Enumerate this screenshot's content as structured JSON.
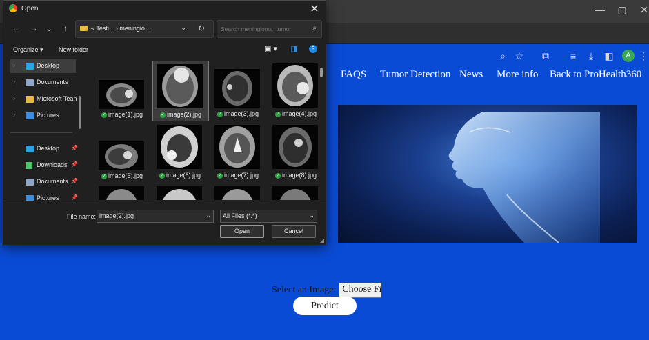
{
  "browser": {
    "window_controls": [
      "—",
      "▢",
      "✕"
    ],
    "avatar_initial": "A"
  },
  "site": {
    "nav": [
      "FAQS",
      "Tumor Detection",
      "News",
      "More info",
      "Back to ProHealth360"
    ],
    "upload_label": "Select an Image:",
    "choose_button": "Choose Fi",
    "predict_button": "Predict"
  },
  "dialog": {
    "title": "Open",
    "breadcrumb": "« Testi...  ›  meningio...",
    "search_placeholder": "Search meningioma_tumor",
    "organize": "Organize ▾",
    "new_folder": "New folder",
    "sidebar": [
      {
        "label": "Desktop",
        "icon": "desktop-icon",
        "color": "#2aa3e0",
        "selected": true,
        "chevron": true
      },
      {
        "label": "Documents",
        "icon": "documents-icon",
        "color": "#8fa6c8",
        "chevron": true
      },
      {
        "label": "Microsoft Tean",
        "icon": "folder-icon",
        "color": "#e8b949",
        "chevron": true
      },
      {
        "label": "Pictures",
        "icon": "pictures-icon",
        "color": "#3b8fe0",
        "chevron": true
      },
      {
        "label": "Desktop",
        "icon": "desktop-icon",
        "color": "#2aa3e0",
        "pinned": true
      },
      {
        "label": "Downloads",
        "icon": "downloads-icon",
        "color": "#4cc36b",
        "pinned": true
      },
      {
        "label": "Documents",
        "icon": "documents-icon",
        "color": "#8fa6c8",
        "pinned": true
      },
      {
        "label": "Pictures",
        "icon": "pictures-icon",
        "color": "#3b8fe0",
        "pinned": true
      }
    ],
    "files": [
      {
        "name": "image(1).jpg",
        "selected": false
      },
      {
        "name": "image(2).jpg",
        "selected": true
      },
      {
        "name": "image(3).jpg",
        "selected": false
      },
      {
        "name": "image(4).jpg",
        "selected": false
      },
      {
        "name": "image(5).jpg",
        "selected": false
      },
      {
        "name": "image(6).jpg",
        "selected": false
      },
      {
        "name": "image(7).jpg",
        "selected": false
      },
      {
        "name": "image(8).jpg",
        "selected": false
      }
    ],
    "file_name_label": "File name:",
    "file_name_value": "image(2).jpg",
    "file_type": "All Files (*.*)",
    "open_button": "Open",
    "cancel_button": "Cancel"
  }
}
